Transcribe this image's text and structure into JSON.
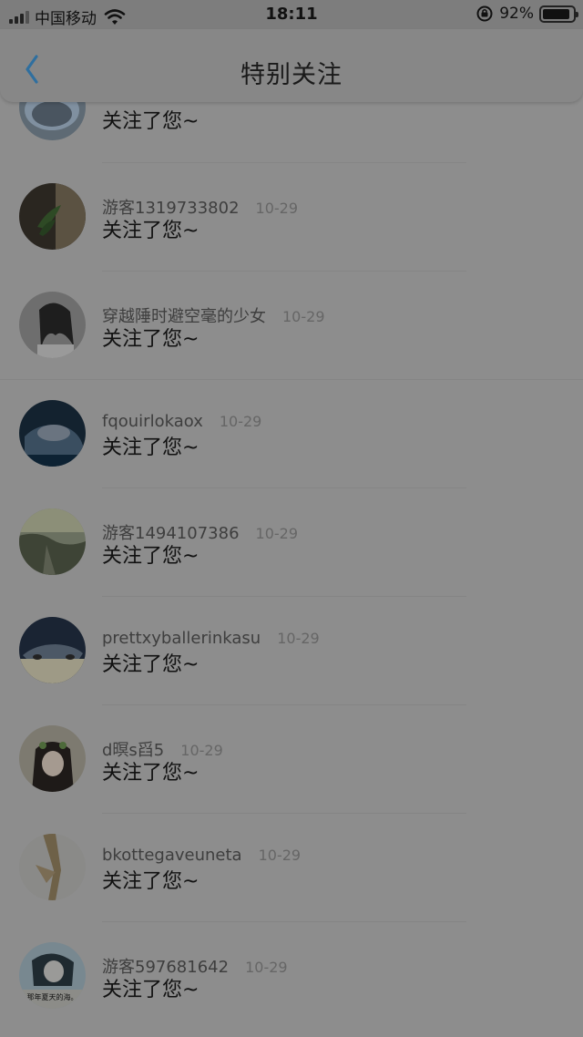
{
  "status_bar": {
    "carrier": "中国移动",
    "time": "18:11",
    "battery_percent": "92%",
    "battery_level": 0.92,
    "icons": [
      "signal-icon",
      "wifi-icon",
      "rotation-lock-icon",
      "battery-icon"
    ]
  },
  "nav": {
    "title": "特别关注",
    "back_icon": "chevron-left-icon",
    "accent": "#2f6f9f"
  },
  "notifications": [
    {
      "username": "",
      "date": "",
      "message": "关注了您~"
    },
    {
      "username": "游客1319733802",
      "date": "10-29",
      "message": "关注了您~"
    },
    {
      "username": "穿越陲时避空毫的少女",
      "date": "10-29",
      "message": "关注了您~"
    },
    {
      "username": "fqouirlokaox",
      "date": "10-29",
      "message": "关注了您~"
    },
    {
      "username": "游客1494107386",
      "date": "10-29",
      "message": "关注了您~"
    },
    {
      "username": "prettxyballerinkasu",
      "date": "10-29",
      "message": "关注了您~"
    },
    {
      "username": "d暝s舀5",
      "date": "10-29",
      "message": "关注了您~"
    },
    {
      "username": "bkottegaveuneta",
      "date": "10-29",
      "message": "关注了您~"
    },
    {
      "username": "游客597681642",
      "date": "10-29",
      "message": "关注了您~"
    }
  ],
  "avatar_captions": {
    "last": "那年夏天的海。"
  }
}
